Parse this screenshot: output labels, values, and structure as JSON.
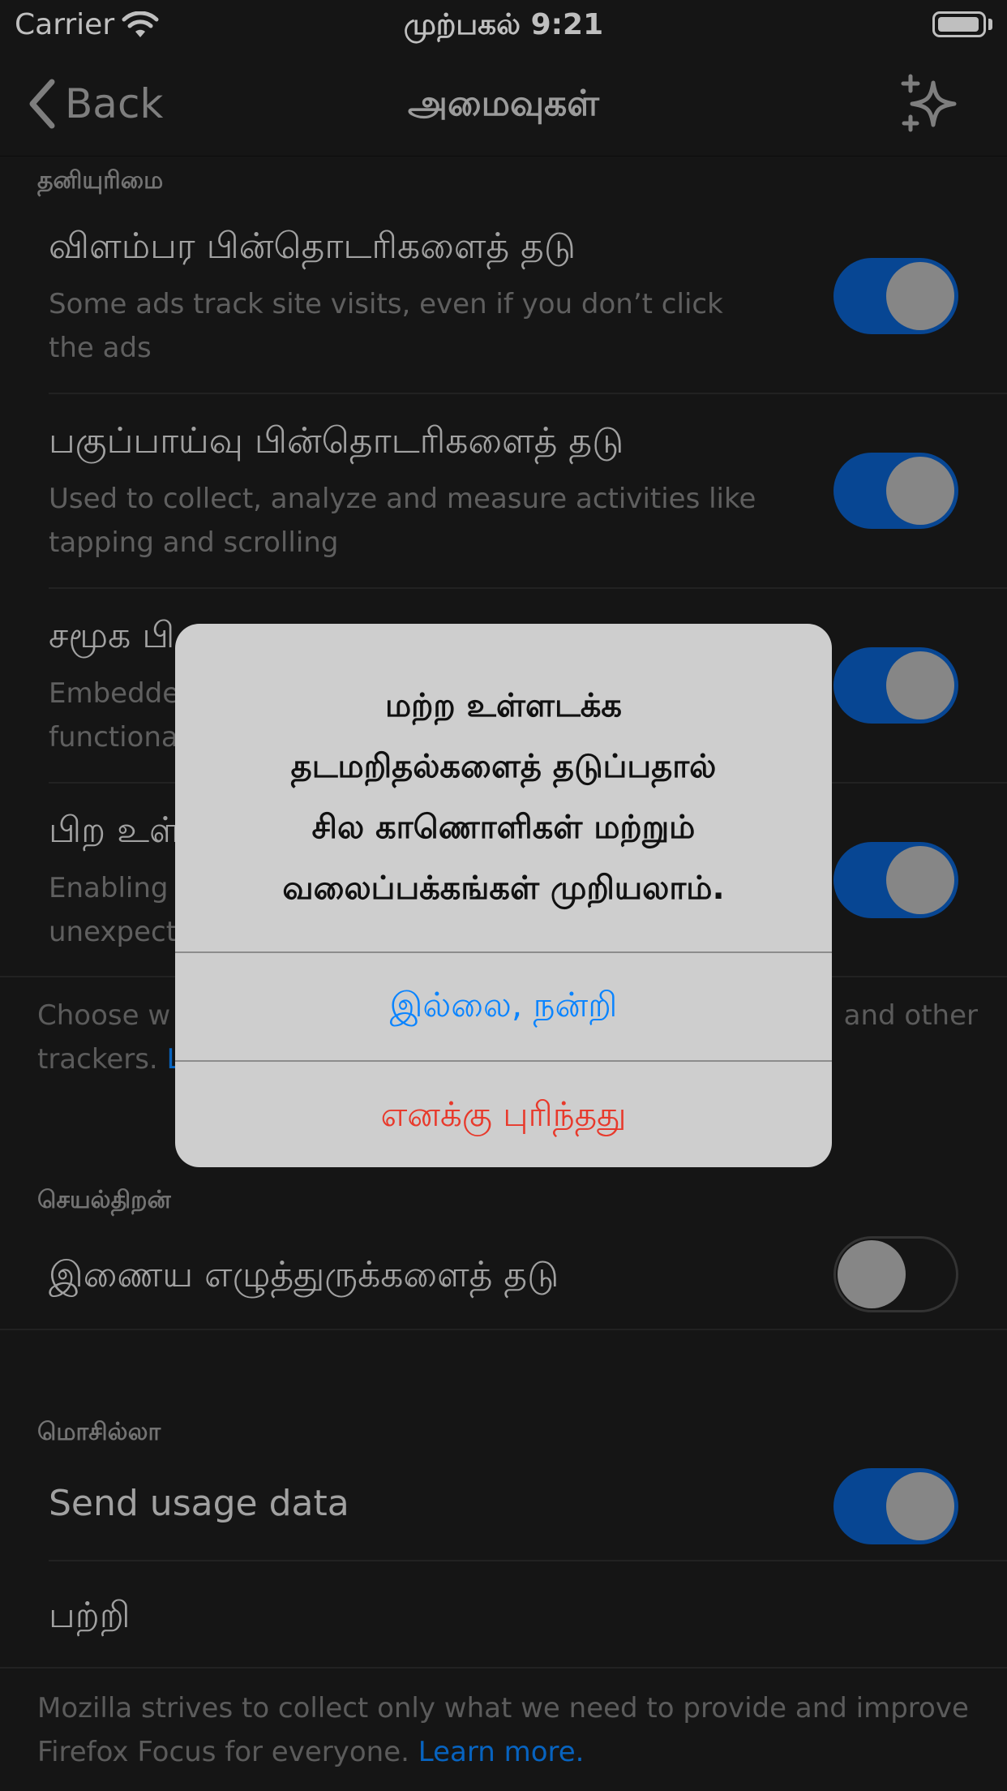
{
  "status_bar": {
    "carrier": "Carrier",
    "time": "முற்பகல் 9:21"
  },
  "nav": {
    "back_label": "Back",
    "title": "அமைவுகள்",
    "right_icon": "sparkle-icon"
  },
  "privacy": {
    "header": "தனியுரிமை",
    "rows": [
      {
        "title": "விளம்பர பின்தொடரிகளைத் தடு",
        "subtitle_l1": "Some ads track site visits, even if you don’t click",
        "subtitle_l2": "the ads",
        "on": true
      },
      {
        "title": "பகுப்பாய்வு பின்தொடரிகளைத் தடு",
        "subtitle_l1": "Used to collect, analyze and measure activities like",
        "subtitle_l2": "tapping and scrolling",
        "on": true
      },
      {
        "title": "சமூக பி",
        "subtitle_l1": "Embedde",
        "subtitle_l2": "functiona",
        "on": true
      },
      {
        "title": "பிற உள்",
        "subtitle_l1": "Enabling",
        "subtitle_l2": "unexpect",
        "on": true
      }
    ],
    "footer_l1_left": "Choose w",
    "footer_l1_right": "and other",
    "footer_l2": "trackers.",
    "footer_link": "L"
  },
  "performance": {
    "header": "செயல்திறன்",
    "row_title": "இணைய எழுத்துருக்களைத் தடு",
    "on": false
  },
  "mozilla": {
    "header": "மொசில்லா",
    "send_usage": "Send usage data",
    "send_usage_on": true,
    "about": "பற்றி",
    "footer_l1": "Mozilla strives to collect only what we need to provide and improve",
    "footer_l2": "Firefox Focus for everyone.",
    "footer_link": "Learn more."
  },
  "alert": {
    "message_lines": [
      "மற்ற உள்ளடக்க",
      "தடமறிதல்களைத் தடுப்பதால்",
      "சில காணொளிகள் மற்றும்",
      "வலைப்பக்கங்கள் முறியலாம்."
    ],
    "cancel_label": "இல்லை, நன்றி",
    "confirm_label": "எனக்கு புரிந்தது"
  },
  "colors": {
    "background": "#1c1c1c",
    "toggle_on": "#0a5ec4",
    "link": "#0a84ff",
    "destructive": "#e8392b",
    "alert_bg": "#cecece"
  }
}
